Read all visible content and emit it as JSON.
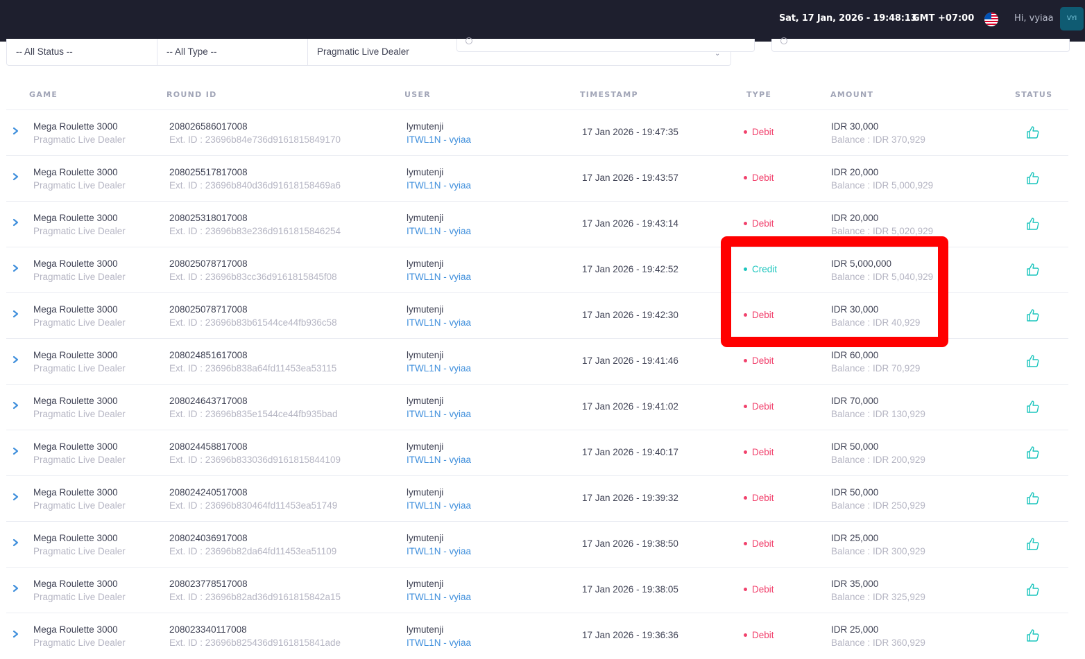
{
  "header": {
    "datetime": "Sat, 17 Jan, 2026 - 19:48:13",
    "timezone": "GMT +07:00",
    "greeting": "Hi, vyiaa",
    "avatar_initials": "VYI",
    "language_flag": "us-flag-icon"
  },
  "filters": {
    "status": "-- All Status --",
    "type": "-- All Type --",
    "provider": "Pragmatic Live Dealer"
  },
  "columns": {
    "game": "GAME",
    "round_id": "ROUND ID",
    "user": "USER",
    "timestamp": "TIMESTAMP",
    "type": "TYPE",
    "amount": "AMOUNT",
    "status": "STATUS"
  },
  "colors": {
    "topbar": "#1e1f2e",
    "debit": "#f1416c",
    "credit": "#1bc5bd",
    "link": "#3f8fdc",
    "highlight_box": "#ff0000"
  },
  "rows": [
    {
      "game": "Mega Roulette 3000",
      "provider": "Pragmatic Live Dealer",
      "round_id": "208026586017008",
      "ext_id": "Ext. ID : 23696b84e736d9161815849170",
      "user": "lymutenji",
      "agent": "ITWL1N - vyiaa",
      "timestamp": "17 Jan 2026 - 19:47:35",
      "type": "Debit",
      "amount": "IDR 30,000",
      "balance": "Balance : IDR 370,929"
    },
    {
      "game": "Mega Roulette 3000",
      "provider": "Pragmatic Live Dealer",
      "round_id": "208025517817008",
      "ext_id": "Ext. ID : 23696b840d36d91618158469a6",
      "user": "lymutenji",
      "agent": "ITWL1N - vyiaa",
      "timestamp": "17 Jan 2026 - 19:43:57",
      "type": "Debit",
      "amount": "IDR 20,000",
      "balance": "Balance : IDR 5,000,929"
    },
    {
      "game": "Mega Roulette 3000",
      "provider": "Pragmatic Live Dealer",
      "round_id": "208025318017008",
      "ext_id": "Ext. ID : 23696b83e236d9161815846254",
      "user": "lymutenji",
      "agent": "ITWL1N - vyiaa",
      "timestamp": "17 Jan 2026 - 19:43:14",
      "type": "Debit",
      "amount": "IDR 20,000",
      "balance": "Balance : IDR 5,020,929"
    },
    {
      "game": "Mega Roulette 3000",
      "provider": "Pragmatic Live Dealer",
      "round_id": "208025078717008",
      "ext_id": "Ext. ID : 23696b83cc36d9161815845f08",
      "user": "lymutenji",
      "agent": "ITWL1N - vyiaa",
      "timestamp": "17 Jan 2026 - 19:42:52",
      "type": "Credit",
      "amount": "IDR 5,000,000",
      "balance": "Balance : IDR 5,040,929"
    },
    {
      "game": "Mega Roulette 3000",
      "provider": "Pragmatic Live Dealer",
      "round_id": "208025078717008",
      "ext_id": "Ext. ID : 23696b83b61544ce44fb936c58",
      "user": "lymutenji",
      "agent": "ITWL1N - vyiaa",
      "timestamp": "17 Jan 2026 - 19:42:30",
      "type": "Debit",
      "amount": "IDR 30,000",
      "balance": "Balance : IDR 40,929"
    },
    {
      "game": "Mega Roulette 3000",
      "provider": "Pragmatic Live Dealer",
      "round_id": "208024851617008",
      "ext_id": "Ext. ID : 23696b838a64fd11453ea53115",
      "user": "lymutenji",
      "agent": "ITWL1N - vyiaa",
      "timestamp": "17 Jan 2026 - 19:41:46",
      "type": "Debit",
      "amount": "IDR 60,000",
      "balance": "Balance : IDR 70,929"
    },
    {
      "game": "Mega Roulette 3000",
      "provider": "Pragmatic Live Dealer",
      "round_id": "208024643717008",
      "ext_id": "Ext. ID : 23696b835e1544ce44fb935bad",
      "user": "lymutenji",
      "agent": "ITWL1N - vyiaa",
      "timestamp": "17 Jan 2026 - 19:41:02",
      "type": "Debit",
      "amount": "IDR 70,000",
      "balance": "Balance : IDR 130,929"
    },
    {
      "game": "Mega Roulette 3000",
      "provider": "Pragmatic Live Dealer",
      "round_id": "208024458817008",
      "ext_id": "Ext. ID : 23696b833036d9161815844109",
      "user": "lymutenji",
      "agent": "ITWL1N - vyiaa",
      "timestamp": "17 Jan 2026 - 19:40:17",
      "type": "Debit",
      "amount": "IDR 50,000",
      "balance": "Balance : IDR 200,929"
    },
    {
      "game": "Mega Roulette 3000",
      "provider": "Pragmatic Live Dealer",
      "round_id": "208024240517008",
      "ext_id": "Ext. ID : 23696b830464fd11453ea51749",
      "user": "lymutenji",
      "agent": "ITWL1N - vyiaa",
      "timestamp": "17 Jan 2026 - 19:39:32",
      "type": "Debit",
      "amount": "IDR 50,000",
      "balance": "Balance : IDR 250,929"
    },
    {
      "game": "Mega Roulette 3000",
      "provider": "Pragmatic Live Dealer",
      "round_id": "208024036917008",
      "ext_id": "Ext. ID : 23696b82da64fd11453ea51109",
      "user": "lymutenji",
      "agent": "ITWL1N - vyiaa",
      "timestamp": "17 Jan 2026 - 19:38:50",
      "type": "Debit",
      "amount": "IDR 25,000",
      "balance": "Balance : IDR 300,929"
    },
    {
      "game": "Mega Roulette 3000",
      "provider": "Pragmatic Live Dealer",
      "round_id": "208023778517008",
      "ext_id": "Ext. ID : 23696b82ad36d9161815842a15",
      "user": "lymutenji",
      "agent": "ITWL1N - vyiaa",
      "timestamp": "17 Jan 2026 - 19:38:05",
      "type": "Debit",
      "amount": "IDR 35,000",
      "balance": "Balance : IDR 325,929"
    },
    {
      "game": "Mega Roulette 3000",
      "provider": "Pragmatic Live Dealer",
      "round_id": "208023340117008",
      "ext_id": "Ext. ID : 23696b825436d9161815841ade",
      "user": "lymutenji",
      "agent": "ITWL1N - vyiaa",
      "timestamp": "17 Jan 2026 - 19:36:36",
      "type": "Debit",
      "amount": "IDR 25,000",
      "balance": "Balance : IDR 360,929"
    }
  ]
}
